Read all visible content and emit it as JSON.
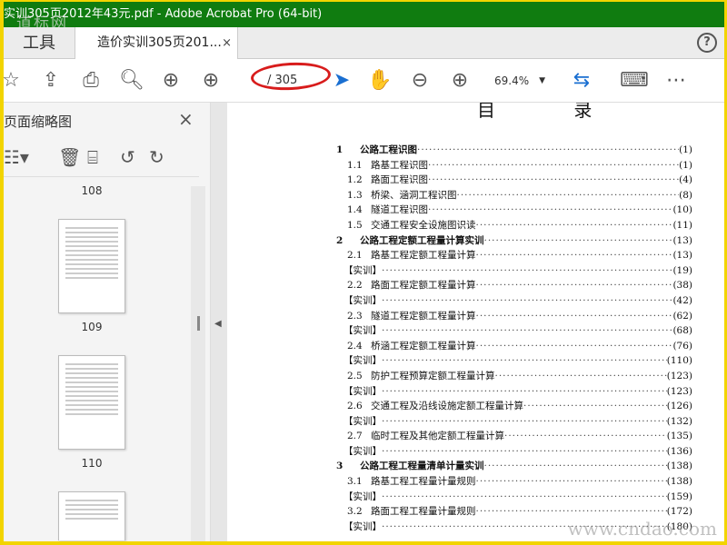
{
  "window": {
    "title": "实训305页2012年43元.pdf - Adobe Acrobat Pro (64-bit)",
    "watermark_top": "道标网"
  },
  "tabs": {
    "tools": "工具",
    "document": "造价实训305页201...",
    "close": "×",
    "help": "?"
  },
  "toolbar": {
    "page_current": "",
    "page_total": "/ 305",
    "zoom": "69.4%"
  },
  "left_panel": {
    "title": "页面缩略图",
    "close": "×",
    "thumbnails": [
      {
        "page": "108"
      },
      {
        "page": "109"
      },
      {
        "page": "110"
      }
    ]
  },
  "document": {
    "heading": "目 录",
    "watermark": "www.cndao.com",
    "toc": [
      {
        "level": 1,
        "num": "1",
        "text": "公路工程识图",
        "page": "(1)"
      },
      {
        "level": 2,
        "num": "1.1",
        "text": "路基工程识图",
        "page": "(1)"
      },
      {
        "level": 2,
        "num": "1.2",
        "text": "路面工程识图",
        "page": "(4)"
      },
      {
        "level": 2,
        "num": "1.3",
        "text": "桥梁、涵洞工程识图",
        "page": "(8)"
      },
      {
        "level": 2,
        "num": "1.4",
        "text": "隧道工程识图",
        "page": "(10)"
      },
      {
        "level": 2,
        "num": "1.5",
        "text": "交通工程安全设施图识读",
        "page": "(11)"
      },
      {
        "level": 1,
        "num": "2",
        "text": "公路工程定额工程量计算实训",
        "page": "(13)"
      },
      {
        "level": 2,
        "num": "2.1",
        "text": "路基工程定额工程量计算",
        "page": "(13)"
      },
      {
        "level": 3,
        "num": "",
        "text": "【实训】",
        "page": "(19)"
      },
      {
        "level": 2,
        "num": "2.2",
        "text": "路面工程定额工程量计算",
        "page": "(38)"
      },
      {
        "level": 3,
        "num": "",
        "text": "【实训】",
        "page": "(42)"
      },
      {
        "level": 2,
        "num": "2.3",
        "text": "隧道工程定额工程量计算",
        "page": "(62)"
      },
      {
        "level": 3,
        "num": "",
        "text": "【实训】",
        "page": "(68)"
      },
      {
        "level": 2,
        "num": "2.4",
        "text": "桥涵工程定额工程量计算",
        "page": "(76)"
      },
      {
        "level": 3,
        "num": "",
        "text": "【实训】",
        "page": "(110)"
      },
      {
        "level": 2,
        "num": "2.5",
        "text": "防护工程预算定额工程量计算",
        "page": "(123)"
      },
      {
        "level": 3,
        "num": "",
        "text": "【实训】",
        "page": "(123)"
      },
      {
        "level": 2,
        "num": "2.6",
        "text": "交通工程及沿线设施定额工程量计算",
        "page": "(126)"
      },
      {
        "level": 3,
        "num": "",
        "text": "【实训】",
        "page": "(132)"
      },
      {
        "level": 2,
        "num": "2.7",
        "text": "临时工程及其他定额工程量计算",
        "page": "(135)"
      },
      {
        "level": 3,
        "num": "",
        "text": "【实训】",
        "page": "(136)"
      },
      {
        "level": 1,
        "num": "3",
        "text": "公路工程工程量清单计量实训",
        "page": "(138)"
      },
      {
        "level": 2,
        "num": "3.1",
        "text": "路基工程工程量计量规则",
        "page": "(138)"
      },
      {
        "level": 3,
        "num": "",
        "text": "【实训】",
        "page": "(159)"
      },
      {
        "level": 2,
        "num": "3.2",
        "text": "路面工程工程量计量规则",
        "page": "(172)"
      },
      {
        "level": 3,
        "num": "",
        "text": "【实训】",
        "page": "(180)"
      }
    ]
  }
}
